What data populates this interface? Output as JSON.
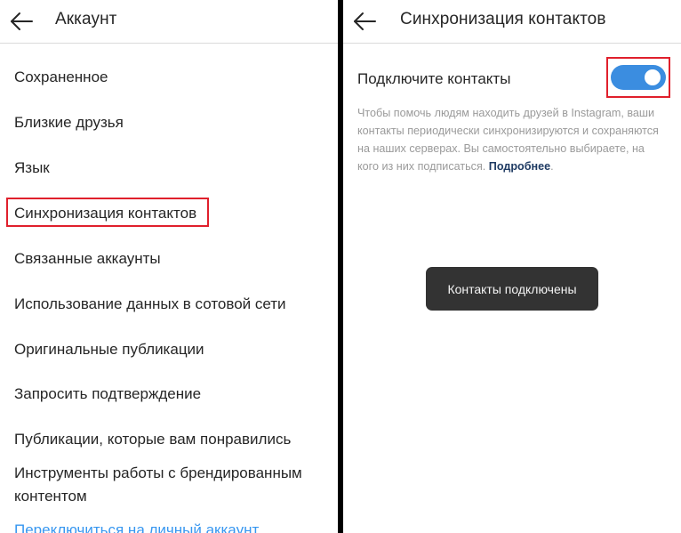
{
  "left_panel": {
    "title": "Аккаунт",
    "items": [
      {
        "label": "Сохраненное"
      },
      {
        "label": "Близкие друзья"
      },
      {
        "label": "Язык"
      },
      {
        "label": "Синхронизация контактов"
      },
      {
        "label": "Связанные аккаунты"
      },
      {
        "label": "Использование данных в сотовой сети"
      },
      {
        "label": "Оригинальные публикации"
      },
      {
        "label": "Запросить подтверждение"
      },
      {
        "label": "Публикации, которые вам понравились"
      },
      {
        "label": "Инструменты работы с брендированным контентом"
      },
      {
        "label": "Переключиться на личный аккаунт"
      }
    ]
  },
  "right_panel": {
    "title": "Синхронизация контактов",
    "connect_label": "Подключите контакты",
    "toggle_on": true,
    "description": "Чтобы помочь людям находить друзей в Instagram, ваши контакты периодически синхронизируются и сохраняются на наших серверах. Вы самостоятельно выбираете, на кого из них подписаться.",
    "more_link": "Подробнее",
    "toast": "Контакты подключены"
  },
  "colors": {
    "accent_toggle": "#3b8de0",
    "link_blue": "#3897f0",
    "highlight_red": "#e0202c",
    "toast_bg": "#333333"
  }
}
